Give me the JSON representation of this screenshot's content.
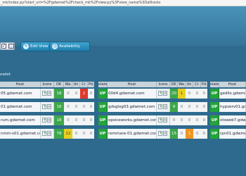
{
  "url": "_mk/index.py?start_url=%2Fgdwmet%2Fcheck_mk%2Fview.py%3Fview_name%3Dallhosts",
  "toolbar": {
    "edit_view": "Edit View",
    "availability": "Availability"
  },
  "section_title": "owlet",
  "headers": {
    "block1": [
      "Host",
      "Icons",
      "OK",
      "Wa",
      "Un",
      "Cr",
      "Pd"
    ],
    "block2": [
      "state",
      "Host",
      "Icons",
      "OK",
      "Wa",
      "Un",
      "Cr",
      "Pd"
    ],
    "block3": [
      "state",
      "Host"
    ]
  },
  "rows": [
    {
      "b1": {
        "host": "05.gdwmet.com",
        "ok": "18",
        "wa": "0",
        "un": "0",
        "cr": "2",
        "pd": "0"
      },
      "b2": {
        "state": "UP",
        "host": "00d4.gdwmet.com",
        "ok": "20",
        "wa": "1",
        "un": "0",
        "cr": "0",
        "pd": "0"
      },
      "b3": {
        "state": "UP",
        "host": "gedllo.gdwmet.com"
      }
    },
    {
      "b1": {
        "host": "01.gdwmet.com",
        "ok": "16",
        "wa": "0",
        "un": "0",
        "cr": "0",
        "pd": "0"
      },
      "b2": {
        "state": "UP",
        "host": "gdsglog03.gdwmet.com",
        "ok": "9",
        "wa": "0",
        "un": "0",
        "cr": "0",
        "pd": "0"
      },
      "b3": {
        "state": "UP",
        "host": "hypserv01.gdwmet.com"
      }
    },
    {
      "b1": {
        "host": "rum.gdwmet.com",
        "ok": "18",
        "wa": "0",
        "un": "0",
        "cr": "0",
        "pd": "0"
      },
      "b2": {
        "state": "UP",
        "host": "opsiceworks.gdwmet.com",
        "ok": "0",
        "wa": "0",
        "un": "0",
        "cr": "0",
        "pd": "0"
      },
      "b3": {
        "state": "UP",
        "host": "otsweb7.gdwmet.com"
      }
    },
    {
      "b1": {
        "host": "nmm-s01.gdwmet.com",
        "ok": "78",
        "wa": "12",
        "un": "0",
        "cr": "0",
        "pd": "0"
      },
      "b2": {
        "state": "UP",
        "host": "remmare-01.gdwmet.com",
        "ok": "15",
        "wa": "0",
        "un": "1",
        "cr": "0",
        "pd": "0"
      },
      "b3": {
        "state": "UP",
        "host": "rpn01.gdwmet.com"
      }
    }
  ],
  "colors": {
    "ok": "#3ea64a",
    "warn": "#e8d022",
    "unknown": "#f19522",
    "critical": "#e0372d",
    "up": "#24a33a"
  }
}
